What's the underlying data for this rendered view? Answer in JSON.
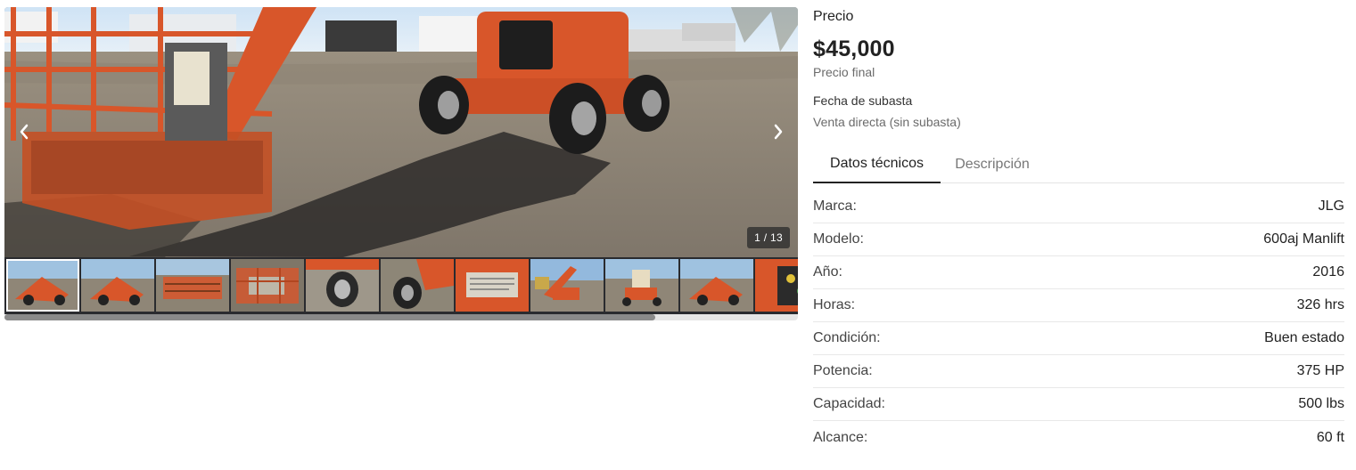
{
  "gallery": {
    "counter": "1 / 13",
    "main_image_alt": "",
    "thumbnails": [
      {
        "kind": "boom-side",
        "active": true
      },
      {
        "kind": "boom-side",
        "active": false
      },
      {
        "kind": "platform",
        "active": false
      },
      {
        "kind": "basket",
        "active": false
      },
      {
        "kind": "wheel",
        "active": false
      },
      {
        "kind": "wheel-body",
        "active": false
      },
      {
        "kind": "plate",
        "active": false
      },
      {
        "kind": "boom-up",
        "active": false
      },
      {
        "kind": "rear",
        "active": false
      },
      {
        "kind": "boom-side",
        "active": false
      },
      {
        "kind": "panel",
        "active": false
      }
    ],
    "scroll_fraction": 0.82,
    "icons": {
      "prev": "chevron-left-icon",
      "next": "chevron-right-icon"
    }
  },
  "price": {
    "label": "Precio",
    "value": "$45,000",
    "sub": "Precio final"
  },
  "auction": {
    "label": "Fecha de subasta",
    "value": "Venta directa (sin subasta)"
  },
  "tabs": [
    {
      "label": "Datos técnicos",
      "active": true
    },
    {
      "label": "Descripción",
      "active": false
    }
  ],
  "specs": [
    {
      "key": "Marca:",
      "value": "JLG"
    },
    {
      "key": "Modelo:",
      "value": "600aj Manlift"
    },
    {
      "key": "Año:",
      "value": "2016"
    },
    {
      "key": "Horas:",
      "value": "326 hrs"
    },
    {
      "key": "Condición:",
      "value": "Buen estado"
    },
    {
      "key": "Potencia:",
      "value": "375 HP"
    },
    {
      "key": "Capacidad:",
      "value": "500 lbs"
    },
    {
      "key": "Alcance:",
      "value": "60 ft"
    }
  ],
  "colors": {
    "machine_orange": "#d8562a",
    "strip_bg": "#2a2b2f",
    "text_primary": "#222222",
    "text_muted": "#6b6b6b"
  }
}
